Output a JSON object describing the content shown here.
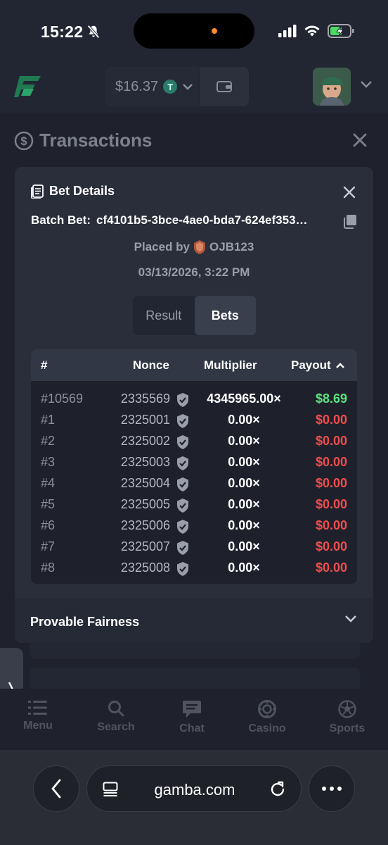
{
  "status_bar": {
    "time": "15:22"
  },
  "header": {
    "balance": "$16.37",
    "currency_icon": "tether-icon",
    "currency_symbol": "T"
  },
  "page": {
    "title": "Transactions"
  },
  "modal": {
    "title": "Bet Details",
    "batch_label": "Batch Bet:",
    "batch_id": "cf4101b5-3bce-4ae0-bda7-624ef353…",
    "placed_by_label": "Placed by",
    "username": "OJB123",
    "datetime": "03/13/2026, 3:22 PM",
    "tabs": [
      {
        "label": "Result",
        "active": false
      },
      {
        "label": "Bets",
        "active": true
      }
    ],
    "table": {
      "headers": {
        "num": "#",
        "nonce": "Nonce",
        "multiplier": "Multiplier",
        "payout": "Payout"
      },
      "rows": [
        {
          "num": "#10569",
          "nonce": "2335569",
          "multiplier": "4345965.00×",
          "payout": "$8.69",
          "win": true
        },
        {
          "num": "#1",
          "nonce": "2325001",
          "multiplier": "0.00×",
          "payout": "$0.00",
          "win": false
        },
        {
          "num": "#2",
          "nonce": "2325002",
          "multiplier": "0.00×",
          "payout": "$0.00",
          "win": false
        },
        {
          "num": "#3",
          "nonce": "2325003",
          "multiplier": "0.00×",
          "payout": "$0.00",
          "win": false
        },
        {
          "num": "#4",
          "nonce": "2325004",
          "multiplier": "0.00×",
          "payout": "$0.00",
          "win": false
        },
        {
          "num": "#5",
          "nonce": "2325005",
          "multiplier": "0.00×",
          "payout": "$0.00",
          "win": false
        },
        {
          "num": "#6",
          "nonce": "2325006",
          "multiplier": "0.00×",
          "payout": "$0.00",
          "win": false
        },
        {
          "num": "#7",
          "nonce": "2325007",
          "multiplier": "0.00×",
          "payout": "$0.00",
          "win": false
        },
        {
          "num": "#8",
          "nonce": "2325008",
          "multiplier": "0.00×",
          "payout": "$0.00",
          "win": false
        }
      ]
    },
    "fairness_label": "Provable Fairness"
  },
  "bottom_nav": [
    {
      "label": "Menu",
      "icon": "menu-icon"
    },
    {
      "label": "Search",
      "icon": "search-icon"
    },
    {
      "label": "Chat",
      "icon": "chat-icon"
    },
    {
      "label": "Casino",
      "icon": "casino-chip-icon"
    },
    {
      "label": "Sports",
      "icon": "soccer-ball-icon"
    }
  ],
  "browser": {
    "url": "gamba.com"
  },
  "colors": {
    "win": "#5ce27e",
    "loss": "#ee4d4d",
    "modal_bg": "#2a2e3b"
  }
}
